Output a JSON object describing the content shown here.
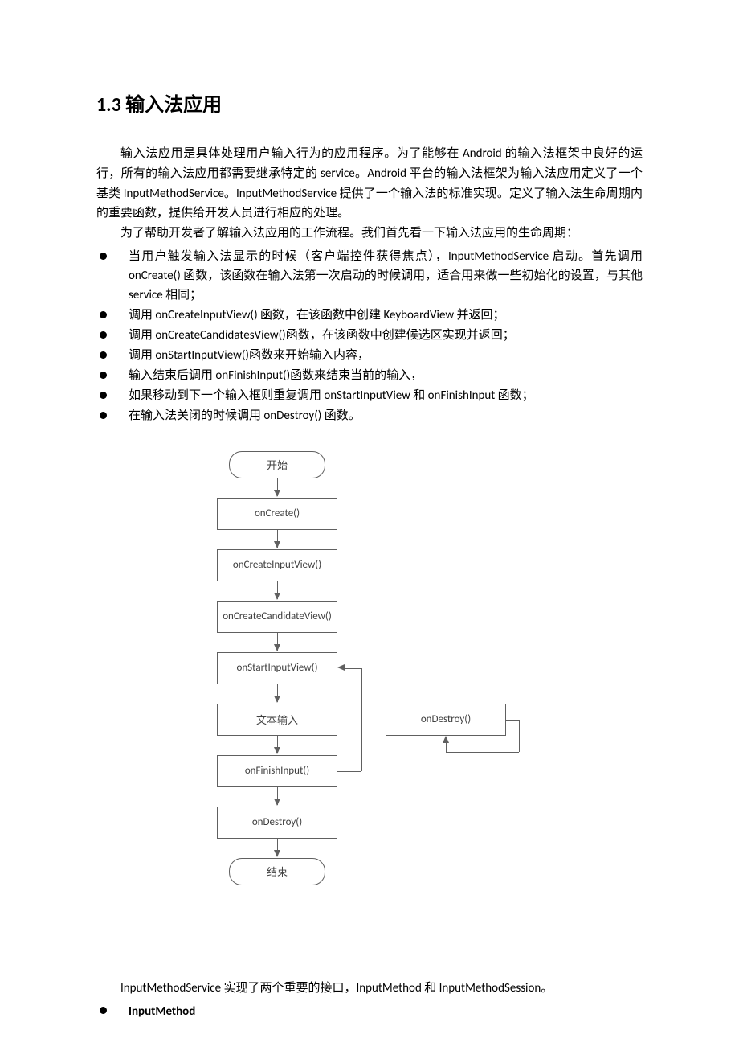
{
  "heading": "1.3 输入法应用",
  "para1": "输入法应用是具体处理用户输入行为的应用程序。为了能够在 Android 的输入法框架中良好的运行，所有的输入法应用都需要继承特定的 service。Android 平台的输入法框架为输入法应用定义了一个基类 InputMethodService。InputMethodService 提供了一个输入法的标准实现。定义了输入法生命周期内的重要函数，提供给开发人员进行相应的处理。",
  "para2": "为了帮助开发者了解输入法应用的工作流程。我们首先看一下输入法应用的生命周期：",
  "bullets": [
    "当用户触发输入法显示的时候（客户端控件获得焦点），InputMethodService 启动。首先调用 onCreate() 函数，该函数在输入法第一次启动的时候调用，适合用来做一些初始化的设置，与其他 service 相同；",
    "调用 onCreateInputView() 函数，在该函数中创建 KeyboardView 并返回；",
    "调用 onCreateCandidatesView()函数，在该函数中创建候选区实现并返回；",
    "调用 onStartInputView()函数来开始输入内容，",
    "输入结束后调用 onFinishInput()函数来结束当前的输入，",
    "如果移动到下一个输入框则重复调用 onStartInputView 和 onFinishInput 函数；",
    "在输入法关闭的时候调用 onDestroy() 函数。"
  ],
  "chart_data": {
    "type": "flowchart",
    "nodes": [
      {
        "id": "start",
        "label": "开始",
        "shape": "terminator"
      },
      {
        "id": "n1",
        "label": "onCreate()",
        "shape": "process"
      },
      {
        "id": "n2",
        "label": "onCreateInputView()",
        "shape": "process"
      },
      {
        "id": "n3",
        "label": "onCreateCandidateView()",
        "shape": "process"
      },
      {
        "id": "n4",
        "label": "onStartInputView()",
        "shape": "process"
      },
      {
        "id": "n5",
        "label": "文本输入",
        "shape": "process"
      },
      {
        "id": "side",
        "label": "onDestroy()",
        "shape": "process"
      },
      {
        "id": "n6",
        "label": "onFinishInput()",
        "shape": "process"
      },
      {
        "id": "n7",
        "label": "onDestroy()",
        "shape": "process"
      },
      {
        "id": "end",
        "label": "结束",
        "shape": "terminator"
      }
    ],
    "edges": [
      {
        "from": "start",
        "to": "n1"
      },
      {
        "from": "n1",
        "to": "n2"
      },
      {
        "from": "n2",
        "to": "n3"
      },
      {
        "from": "n3",
        "to": "n4"
      },
      {
        "from": "n4",
        "to": "n5"
      },
      {
        "from": "n5",
        "to": "n6"
      },
      {
        "from": "n6",
        "to": "n7"
      },
      {
        "from": "n7",
        "to": "end"
      },
      {
        "from": "n6",
        "to": "n4",
        "loop": true
      },
      {
        "from": "side",
        "to": "side",
        "loop": true
      }
    ]
  },
  "para3": "InputMethodService 实现了两个重要的接口，InputMethod 和 InputMethodSession。",
  "bullets2": [
    "InputMethod"
  ]
}
